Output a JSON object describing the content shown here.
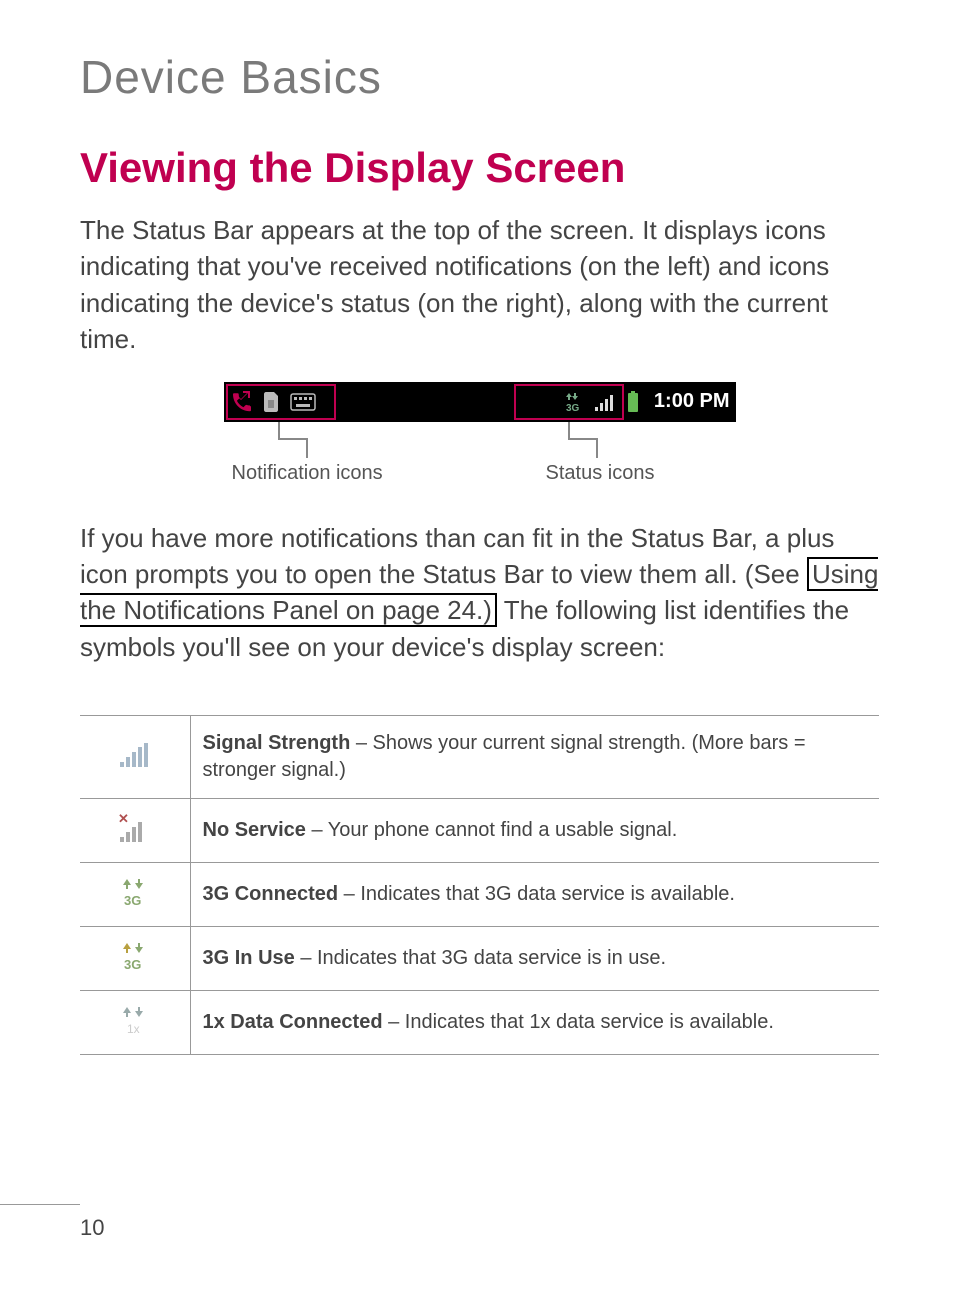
{
  "chapter": "Device Basics",
  "section": "Viewing the Display Screen",
  "intro": "The Status Bar appears at the top of the screen. It displays icons indicating that you've received notifications (on the left) and icons indicating the device's status (on the right), along with the current time.",
  "statusbar": {
    "time": "1:00 PM",
    "notification_label": "Notification icons",
    "status_label": "Status icons"
  },
  "para2_pre": "If you have more notifications than can fit in the Status Bar, a plus icon prompts you to open the Status Bar to view them all. (See ",
  "para2_link": "Using the Notifications Panel on page 24.)",
  "para2_post": " The following list identifies the symbols you'll see on your device's display screen:",
  "rows": [
    {
      "term": "Signal Strength",
      "desc": " – Shows your current signal strength. (More bars = stronger signal.)"
    },
    {
      "term": "No Service",
      "desc": " – Your phone cannot find a usable signal."
    },
    {
      "term": "3G Connected",
      "desc": " – Indicates that 3G data service is available."
    },
    {
      "term": "3G In Use",
      "desc": " – Indicates that 3G data service is in use."
    },
    {
      "term": "1x Data Connected",
      "desc": " – Indicates that 1x data service is available."
    }
  ],
  "page_number": "10"
}
